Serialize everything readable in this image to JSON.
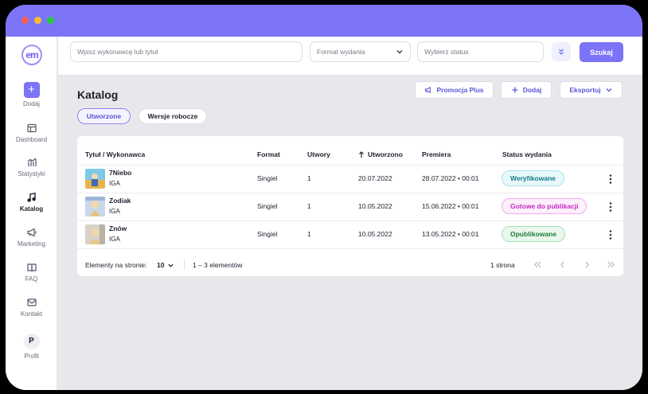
{
  "nav": {
    "items": [
      {
        "label": "Dodaj",
        "icon": "plus-icon"
      },
      {
        "label": "Dashboard",
        "icon": "dashboard-icon"
      },
      {
        "label": "Statystyki",
        "icon": "stats-icon"
      },
      {
        "label": "Katalog",
        "icon": "music-note-icon",
        "active": true
      },
      {
        "label": "Marketing",
        "icon": "megaphone-icon"
      },
      {
        "label": "FAQ",
        "icon": "book-icon"
      },
      {
        "label": "Kontakt",
        "icon": "mail-icon"
      },
      {
        "label": "Profil",
        "icon": "profile-badge",
        "initial": "P"
      }
    ],
    "logo_text": "em"
  },
  "search": {
    "query_placeholder": "Wpisz wykonawcę lub tytuł",
    "format_placeholder": "Format wydania",
    "status_placeholder": "Wybierz status",
    "search_label": "Szukaj"
  },
  "page": {
    "title": "Katalog",
    "actions": {
      "promo": "Promocja Plus",
      "add": "Dodaj",
      "export": "Eksportuj"
    },
    "tabs": [
      {
        "label": "Utworzone",
        "active": true
      },
      {
        "label": "Wersje robocze",
        "active": false
      }
    ]
  },
  "table": {
    "columns": [
      "Tytuł / Wykonawca",
      "Format",
      "Utwory",
      "Utworzono",
      "Premiera",
      "Status wydania"
    ],
    "sort_column": "Utworzono",
    "rows": [
      {
        "title": "7Niebo",
        "artist": "IGA",
        "format": "Singiel",
        "tracks": "1",
        "created": "20.07.2022",
        "release": "28.07.2022 • 00:01",
        "status": "Weryfikowane",
        "status_color": "teal"
      },
      {
        "title": "Zodiak",
        "artist": "IGA",
        "format": "Singiel",
        "tracks": "1",
        "created": "10.05.2022",
        "release": "15.06.2022 • 00:01",
        "status": "Gotowe do publikacji",
        "status_color": "pink"
      },
      {
        "title": "Znów",
        "artist": "IGA",
        "format": "Singiel",
        "tracks": "1",
        "created": "10.05.2022",
        "release": "13.05.2022 • 00:01",
        "status": "Opublikowane",
        "status_color": "green"
      }
    ],
    "footer": {
      "per_page_label": "Elementy na stronie:",
      "per_page_value": "10",
      "range": "1 – 3 elementów",
      "pages": "1 strona"
    }
  },
  "colors": {
    "accent": "#7b74f7",
    "background": "#e8e8ec"
  }
}
